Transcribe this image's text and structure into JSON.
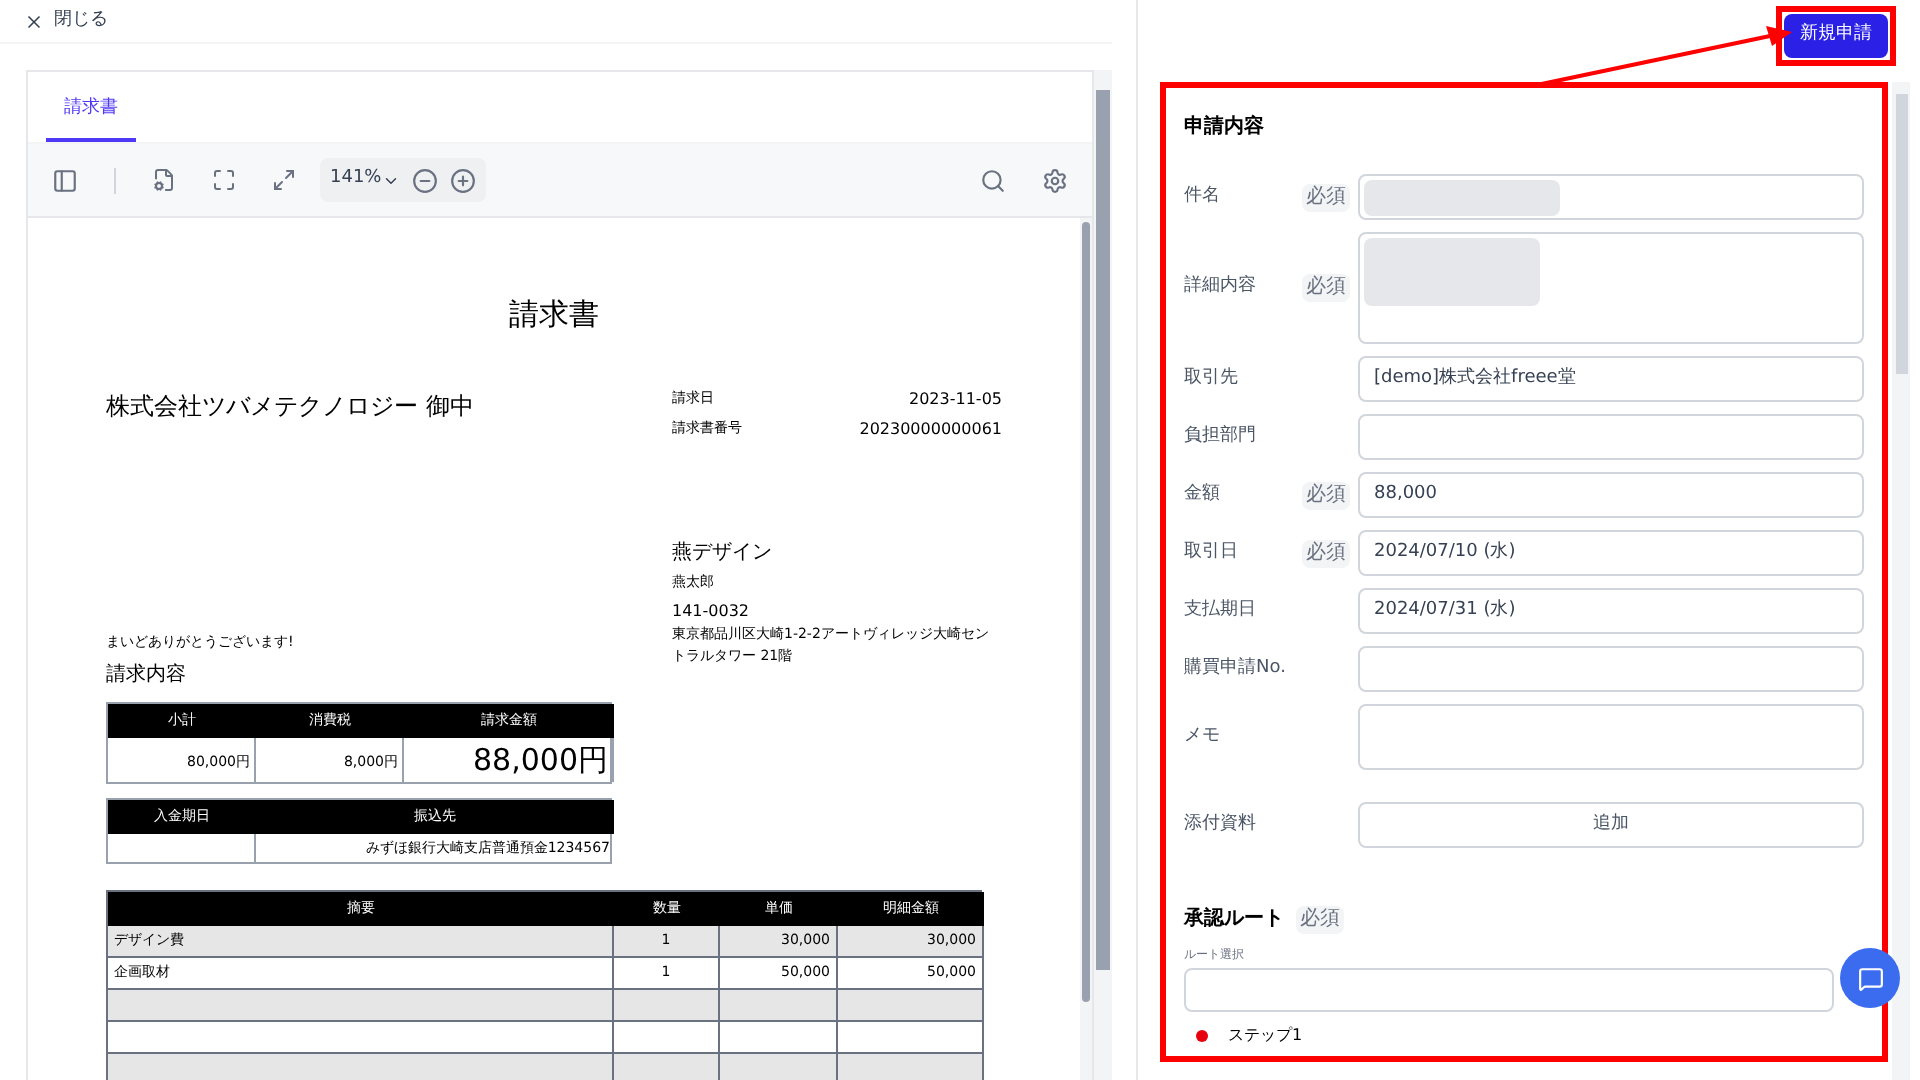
{
  "close_button": {
    "label": "閉じる"
  },
  "viewer": {
    "tabs": [
      {
        "label": "請求書",
        "selected": true
      }
    ],
    "zoom": "141%"
  },
  "invoice": {
    "title": "請求書",
    "recipient": "株式会社ツバメテクノロジー 御中",
    "meta": [
      {
        "label": "請求日",
        "value": "2023-11-05"
      },
      {
        "label": "請求書番号",
        "value": "20230000000061"
      }
    ],
    "issuer": {
      "name": "燕デザイン",
      "person": "燕太郎",
      "postal": "141-0032",
      "address": "東京都品川区大崎1-2-2アートヴィレッジ大崎セントラルタワー 21階"
    },
    "greeting": "まいどありがとうございます!",
    "section_title": "請求内容",
    "summary": {
      "columns": [
        "小計",
        "消費税",
        "請求金額"
      ],
      "values": [
        "80,000円",
        "8,000円",
        "88,000円"
      ]
    },
    "payment": {
      "columns": [
        "入金期日",
        "振込先"
      ],
      "account": "みずほ銀行大崎支店普通預金1234567"
    },
    "items": {
      "columns": [
        "摘要",
        "数量",
        "単価",
        "明細金額"
      ],
      "rows": [
        [
          "デザイン費",
          "1",
          "30,000",
          "30,000"
        ],
        [
          "企画取材",
          "1",
          "50,000",
          "50,000"
        ]
      ]
    }
  },
  "submit_button": {
    "label": "新規申請"
  },
  "form": {
    "title": "申請内容",
    "fields": [
      {
        "label": "件名",
        "badge": "必須",
        "kind": "input",
        "redacted": true
      },
      {
        "label": "詳細内容",
        "badge": "必須",
        "kind": "textarea",
        "redacted": true
      },
      {
        "label": "取引先",
        "kind": "input",
        "value": "[demo]株式会社freee堂"
      },
      {
        "label": "負担部門",
        "kind": "input"
      },
      {
        "label": "金額",
        "badge": "必須",
        "kind": "input",
        "value": "88,000"
      },
      {
        "label": "取引日",
        "badge": "必須",
        "kind": "input",
        "value": "2024/07/10 (水)"
      },
      {
        "label": "支払期日",
        "kind": "input",
        "value": "2024/07/31 (水)"
      },
      {
        "label": "購買申請No.",
        "kind": "input"
      },
      {
        "label": "メモ",
        "kind": "textarea"
      },
      {
        "label": "添付資料",
        "kind": "button",
        "value": "追加"
      }
    ]
  },
  "approval": {
    "title": "承認ルート",
    "badge": "必須",
    "route_label": "ルート選択",
    "steps": [
      {
        "label": "ステップ1"
      }
    ]
  }
}
